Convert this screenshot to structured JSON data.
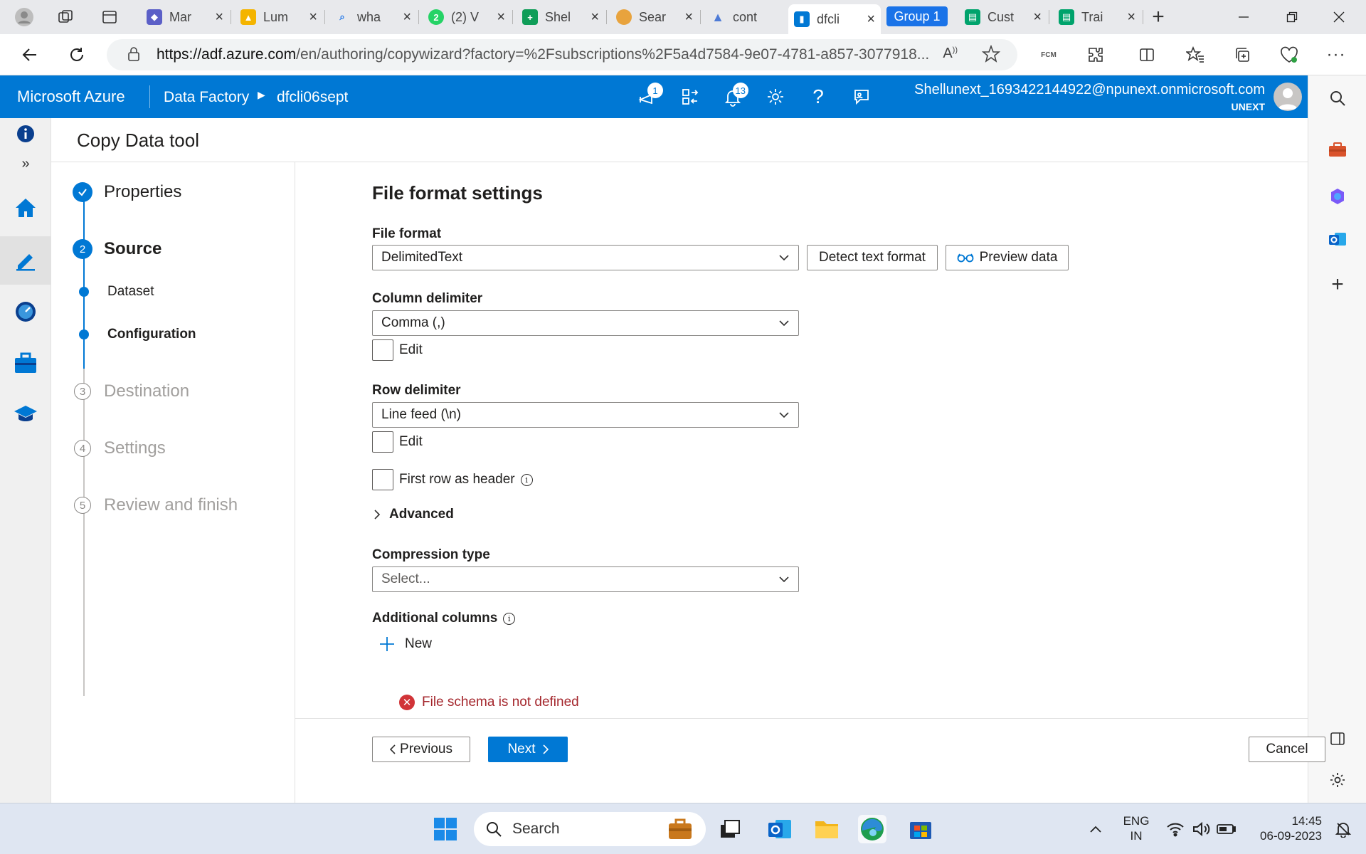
{
  "browser": {
    "tabs": [
      {
        "label": "Mar",
        "color": "#5b5fc7"
      },
      {
        "label": "Lum",
        "color": "#f4b400"
      },
      {
        "label": "wha",
        "color": "#1a73e8"
      },
      {
        "label": "(2) V",
        "color": "#25d366"
      },
      {
        "label": "Shel",
        "color": "#0f9d58"
      },
      {
        "label": "Sear",
        "color": "#e8a33d"
      },
      {
        "label": "cont",
        "color": "#4e7bd6"
      },
      {
        "label": "dfcli",
        "color": "#0078d4"
      }
    ],
    "group_label": "Group 1",
    "group_tabs": [
      {
        "label": "Cust",
        "color": "#00a36c"
      },
      {
        "label": "Trai",
        "color": "#00a36c"
      }
    ],
    "url_host": "https://adf.azure.com",
    "url_path": "/en/authoring/copywizard?factory=%2Fsubscriptions%2F5a4d7584-9e07-4781-a857-3077918..."
  },
  "azure": {
    "brand": "Microsoft Azure",
    "breadcrumb": [
      "Data Factory",
      "dfcli06sept"
    ],
    "news_badge": "1",
    "notifications_badge": "13",
    "user_email": "Shellunext_1693422144922@npunext.onmicrosoft.com",
    "user_org": "UNEXT"
  },
  "panel": {
    "title": "Copy Data tool",
    "steps": [
      {
        "label": "Properties",
        "state": "done"
      },
      {
        "label": "Source",
        "number": "2",
        "state": "current"
      },
      {
        "label": "Dataset",
        "state": "sub"
      },
      {
        "label": "Configuration",
        "state": "sub-current"
      },
      {
        "label": "Destination",
        "number": "3",
        "state": "pending"
      },
      {
        "label": "Settings",
        "number": "4",
        "state": "pending"
      },
      {
        "label": "Review and finish",
        "number": "5",
        "state": "pending"
      }
    ]
  },
  "form": {
    "section_title": "File format settings",
    "file_format_label": "File format",
    "file_format_value": "DelimitedText",
    "detect_button": "Detect text format",
    "preview_button": "Preview data",
    "column_delimiter_label": "Column delimiter",
    "column_delimiter_value": "Comma (,)",
    "edit_label": "Edit",
    "row_delimiter_label": "Row delimiter",
    "row_delimiter_value": "Line feed (\\n)",
    "first_row_label": "First row as header",
    "advanced_label": "Advanced",
    "compression_label": "Compression type",
    "compression_placeholder": "Select...",
    "additional_columns_label": "Additional columns",
    "new_label": "New",
    "error_text": "File schema is not defined",
    "previous_button": "Previous",
    "next_button": "Next",
    "cancel_button": "Cancel"
  },
  "taskbar": {
    "search_placeholder": "Search",
    "lang_line1": "ENG",
    "lang_line2": "IN",
    "time": "14:45",
    "date": "06-09-2023"
  }
}
